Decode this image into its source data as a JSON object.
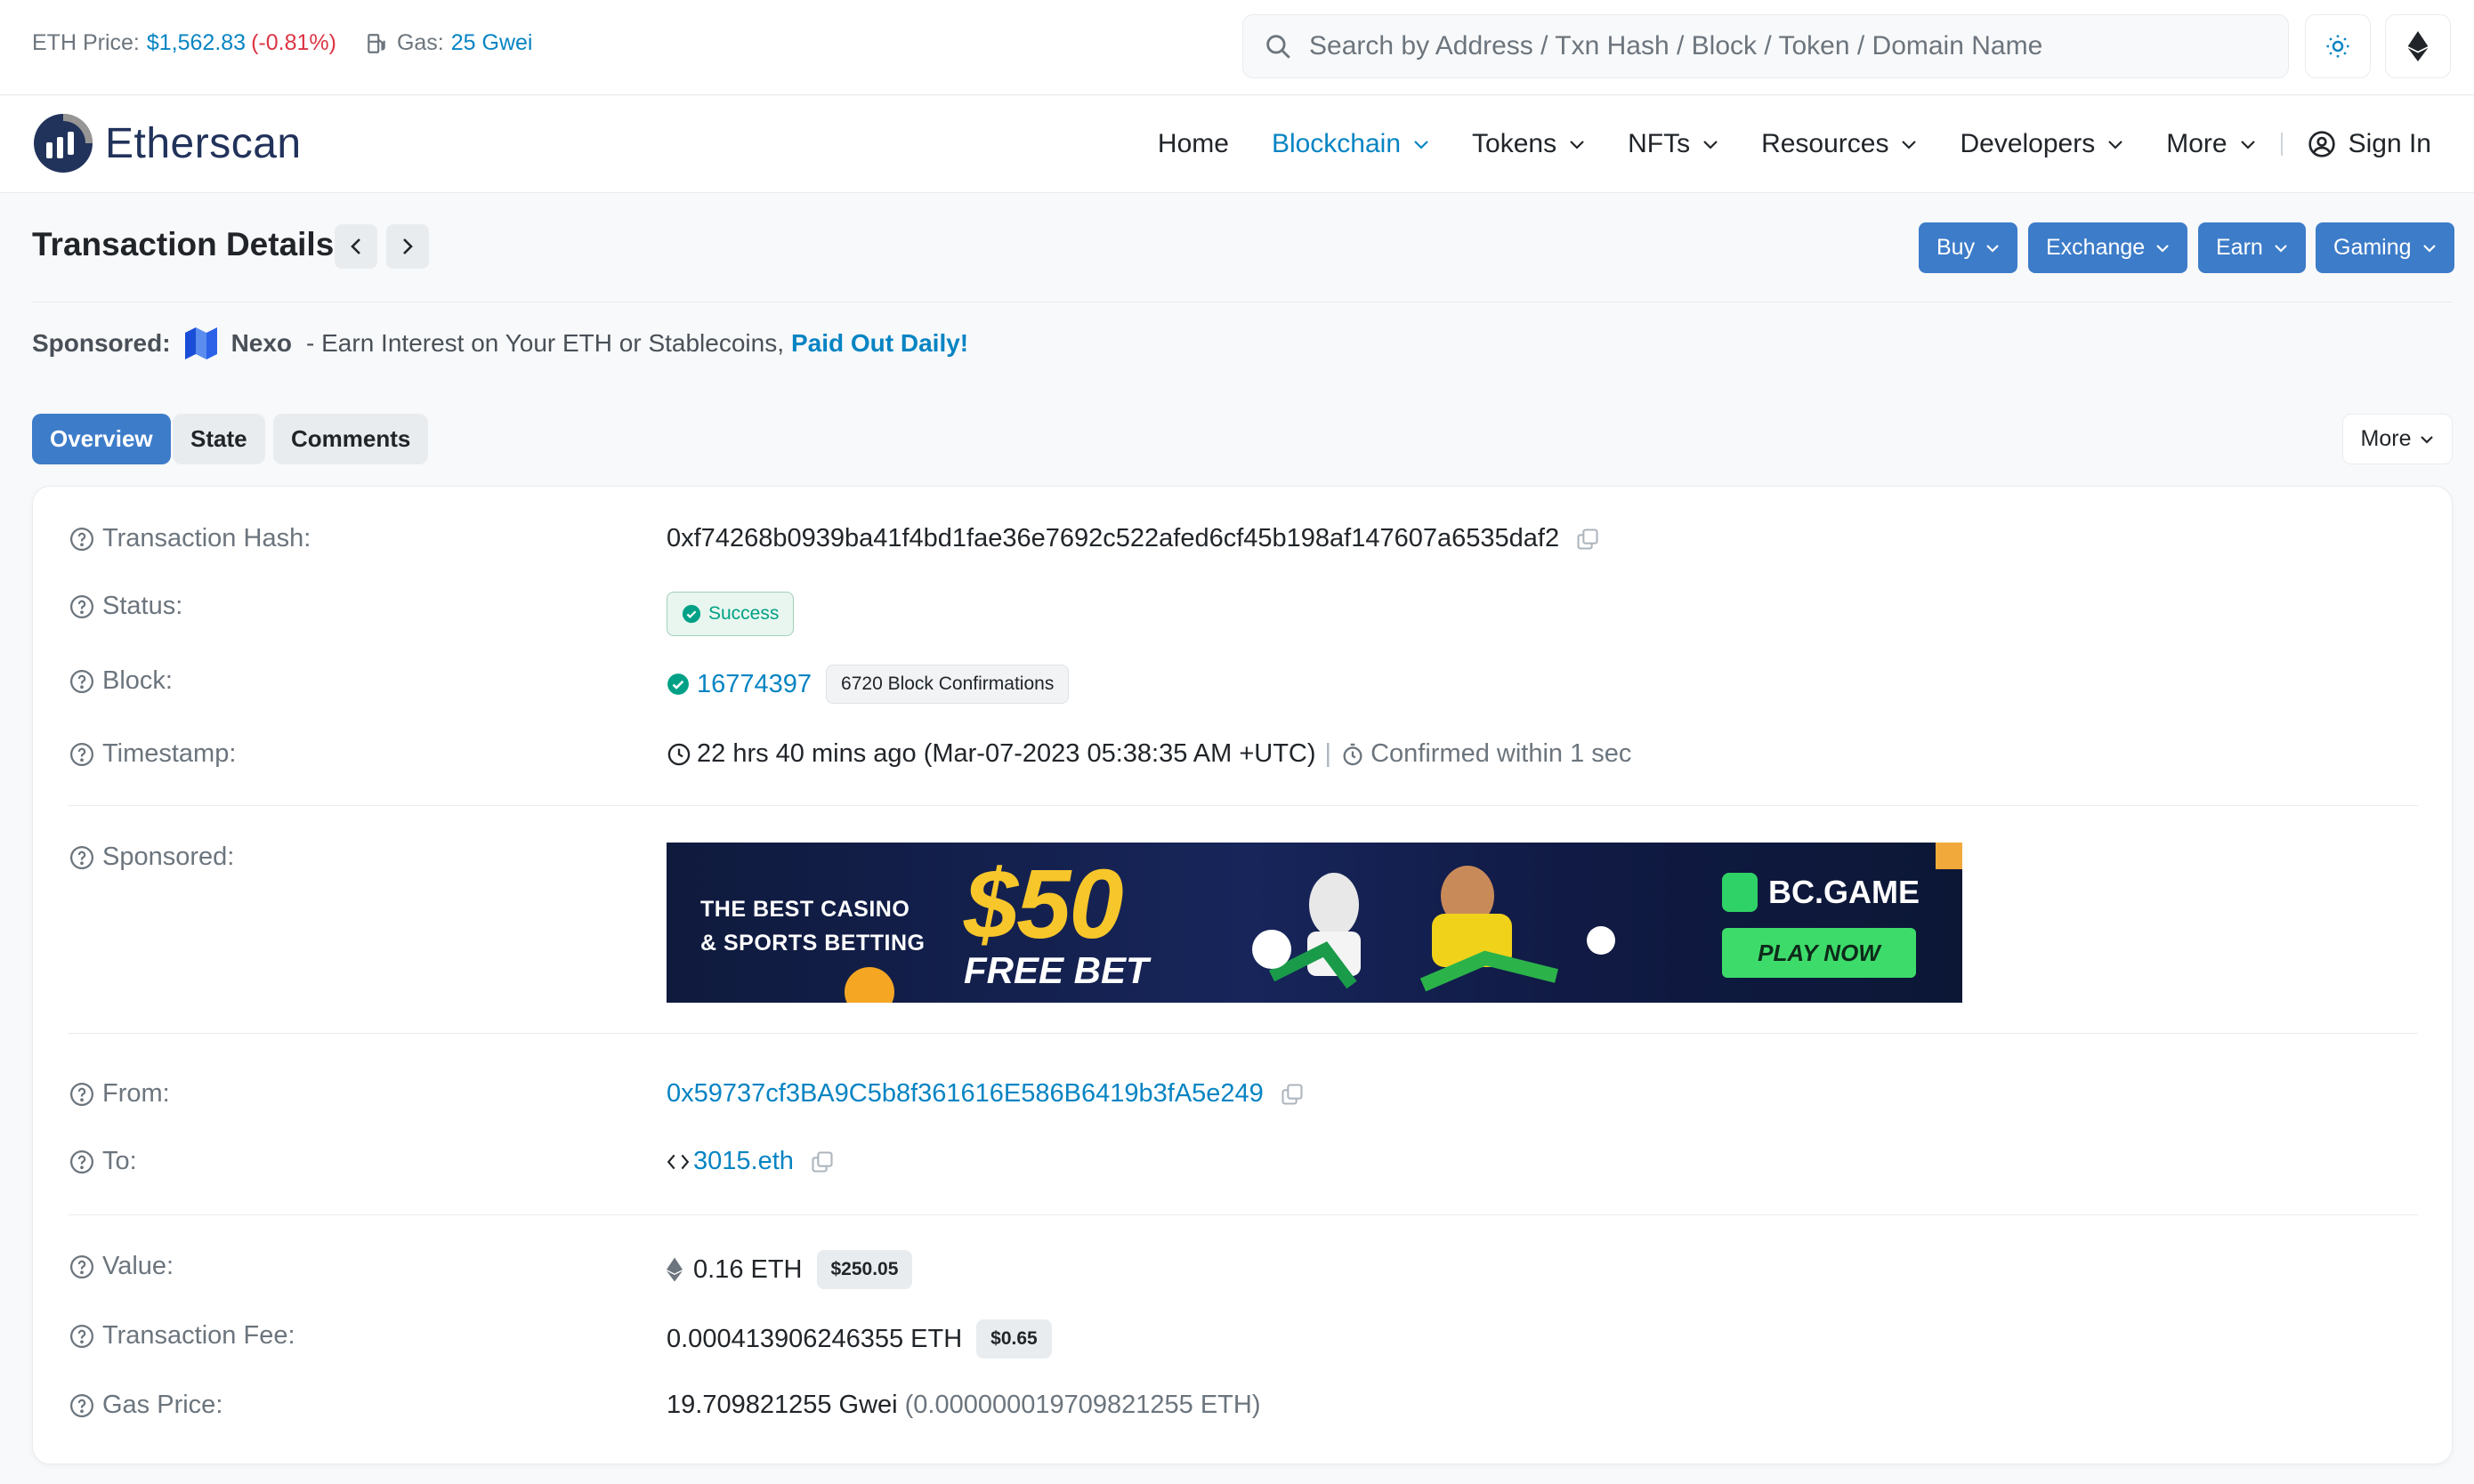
{
  "topbar": {
    "eth_price_label": "ETH Price:",
    "eth_price_value": "$1,562.83",
    "eth_price_change": "(-0.81%)",
    "gas_label": "Gas:",
    "gas_value": "25 Gwei",
    "search_placeholder": "Search by Address / Txn Hash / Block / Token / Domain Name"
  },
  "nav": {
    "logo": "Etherscan",
    "items": [
      "Home",
      "Blockchain",
      "Tokens",
      "NFTs",
      "Resources",
      "Developers",
      "More"
    ],
    "sign_in": "Sign In"
  },
  "page": {
    "title": "Transaction Details",
    "buttons": [
      "Buy",
      "Exchange",
      "Earn",
      "Gaming"
    ]
  },
  "sponsored_line": {
    "label": "Sponsored:",
    "dash": "-",
    "brand": "Nexo",
    "text": "- Earn Interest on Your ETH or Stablecoins,",
    "link": "Paid Out Daily!"
  },
  "tabs": [
    "Overview",
    "State",
    "Comments"
  ],
  "more_label": "More",
  "details": {
    "hash_label": "Transaction Hash:",
    "hash": "0xf74268b0939ba41f4bd1fae36e7692c522afed6cf45b198af147607a6535daf2",
    "status_label": "Status:",
    "status": "Success",
    "block_label": "Block:",
    "block": "16774397",
    "confirmations": "6720 Block Confirmations",
    "timestamp_label": "Timestamp:",
    "timestamp": "22 hrs 40 mins ago (Mar-07-2023 05:38:35 AM +UTC)",
    "timestamp_sep": "|",
    "confirmed_within": "Confirmed within 1 sec",
    "sponsored_label": "Sponsored:",
    "banner": {
      "tagline_1": "THE BEST CASINO",
      "tagline_2": "& SPORTS BETTING",
      "amount": "$50",
      "free_bet": "FREE BET",
      "brand": "BC.GAME",
      "cta": "PLAY NOW"
    },
    "from_label": "From:",
    "from": "0x59737cf3BA9C5b8f361616E586B6419b3fA5e249",
    "to_label": "To:",
    "to": "3015.eth",
    "value_label": "Value:",
    "value": "0.16 ETH",
    "value_usd": "$250.05",
    "fee_label": "Transaction Fee:",
    "fee": "0.000413906246355 ETH",
    "fee_usd": "$0.65",
    "gas_price_label": "Gas Price:",
    "gas_price": "19.709821255 Gwei",
    "gas_price_eth": "(0.000000019709821255 ETH)"
  },
  "colors": {
    "link": "#0784c3",
    "primary_button": "#3d7cc9",
    "negative": "#dc3545",
    "success": "#00a186"
  }
}
